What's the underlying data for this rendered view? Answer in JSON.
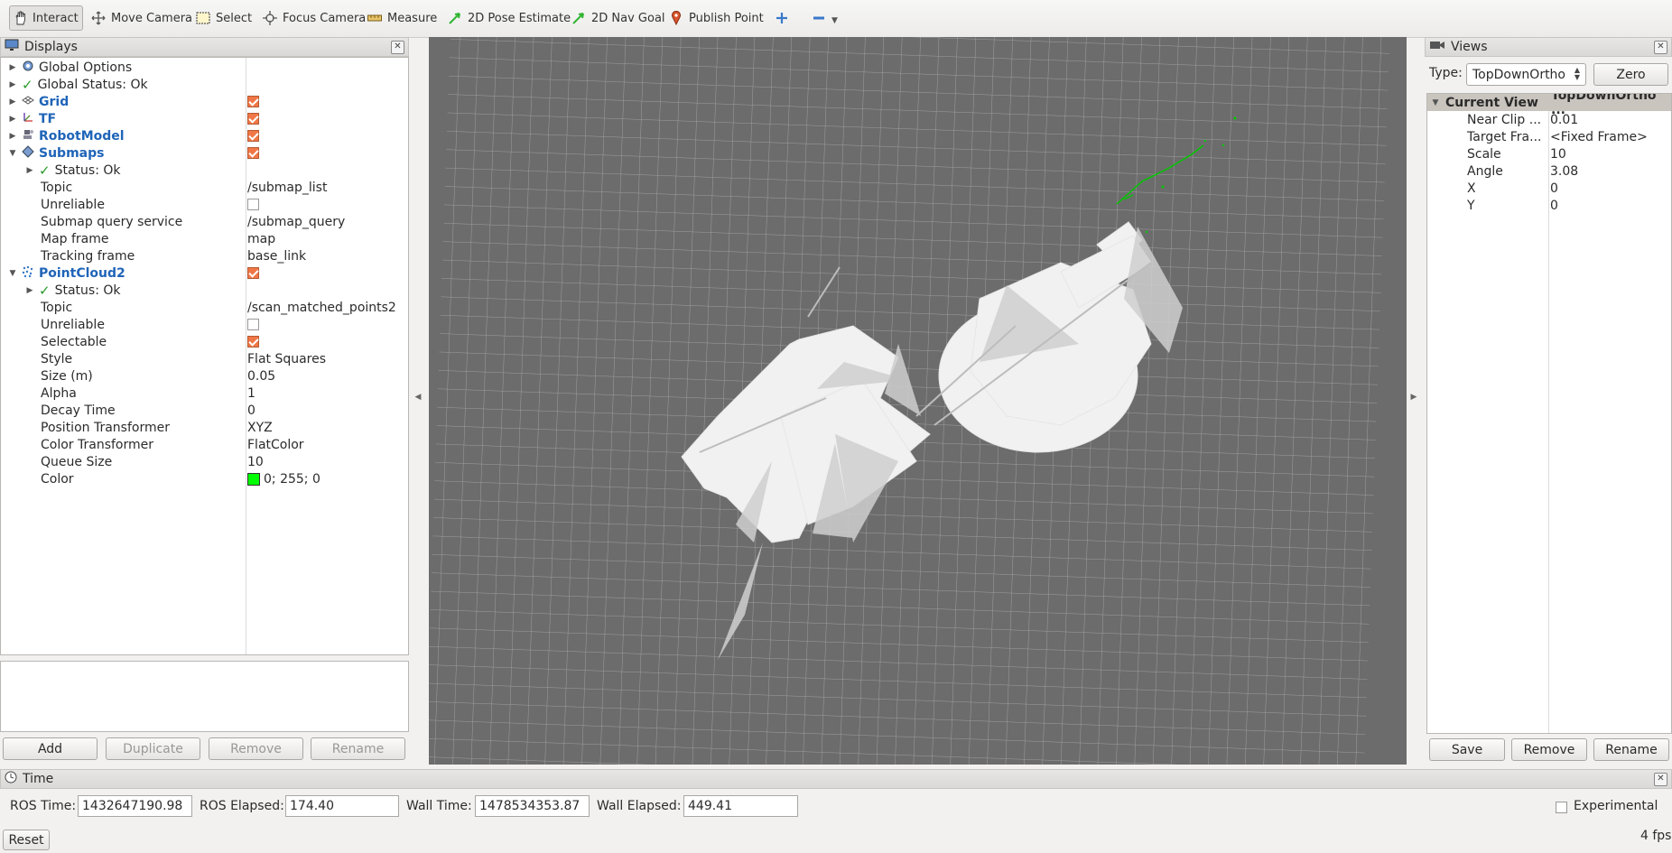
{
  "toolbar": {
    "tools": [
      {
        "label": "Interact",
        "icon": "hand-icon"
      },
      {
        "label": "Move Camera",
        "icon": "move-camera-icon"
      },
      {
        "label": "Select",
        "icon": "select-icon"
      },
      {
        "label": "Focus Camera",
        "icon": "focus-camera-icon"
      },
      {
        "label": "Measure",
        "icon": "ruler-icon"
      },
      {
        "label": "2D Pose Estimate",
        "icon": "pose-arrow-icon"
      },
      {
        "label": "2D Nav Goal",
        "icon": "goal-arrow-icon"
      },
      {
        "label": "Publish Point",
        "icon": "map-pin-icon"
      }
    ],
    "active": "Interact"
  },
  "displays": {
    "title": "Displays",
    "rows": [
      {
        "label": "Global Options"
      },
      {
        "label": "Global Status: Ok"
      },
      {
        "label": "Grid"
      },
      {
        "label": "TF"
      },
      {
        "label": "RobotModel"
      },
      {
        "label": "Submaps"
      },
      {
        "label": "Status: Ok"
      },
      {
        "label": "Topic",
        "value": "/submap_list"
      },
      {
        "label": "Unreliable"
      },
      {
        "label": "Submap query service",
        "value": "/submap_query"
      },
      {
        "label": "Map frame",
        "value": "map"
      },
      {
        "label": "Tracking frame",
        "value": "base_link"
      },
      {
        "label": "PointCloud2"
      },
      {
        "label": "Status: Ok"
      },
      {
        "label": "Topic",
        "value": "/scan_matched_points2"
      },
      {
        "label": "Unreliable"
      },
      {
        "label": "Selectable"
      },
      {
        "label": "Style",
        "value": "Flat Squares"
      },
      {
        "label": "Size (m)",
        "value": "0.05"
      },
      {
        "label": "Alpha",
        "value": "1"
      },
      {
        "label": "Decay Time",
        "value": "0"
      },
      {
        "label": "Position Transformer",
        "value": "XYZ"
      },
      {
        "label": "Color Transformer",
        "value": "FlatColor"
      },
      {
        "label": "Queue Size",
        "value": "10"
      },
      {
        "label": "Color",
        "value": "0; 255; 0"
      }
    ],
    "buttons": {
      "add": "Add",
      "duplicate": "Duplicate",
      "remove": "Remove",
      "rename": "Rename"
    }
  },
  "views": {
    "title": "Views",
    "type_label": "Type:",
    "type_value": "TopDownOrtho",
    "zero_label": "Zero",
    "header": {
      "col1": "Current View",
      "col2": "TopDownOrtho ..."
    },
    "props": [
      {
        "label": "Near Clip ...",
        "value": "0.01"
      },
      {
        "label": "Target Fra...",
        "value": "<Fixed Frame>"
      },
      {
        "label": "Scale",
        "value": "10"
      },
      {
        "label": "Angle",
        "value": "3.08"
      },
      {
        "label": "X",
        "value": "0"
      },
      {
        "label": "Y",
        "value": "0"
      }
    ],
    "buttons": {
      "save": "Save",
      "remove": "Remove",
      "rename": "Rename"
    }
  },
  "time": {
    "title": "Time",
    "ros_time_label": "ROS Time:",
    "ros_time": "1432647190.98",
    "ros_elapsed_label": "ROS Elapsed:",
    "ros_elapsed": "174.40",
    "wall_time_label": "Wall Time:",
    "wall_time": "1478534353.87",
    "wall_elapsed_label": "Wall Elapsed:",
    "wall_elapsed": "449.41",
    "experimental_label": "Experimental",
    "reset_label": "Reset",
    "fps": "4 fps"
  },
  "colors": {
    "accent_checkbox": "#f07746",
    "tree_blue": "#1f64b8",
    "point_cloud": "#00ff00",
    "viewport_bg": "#6c6c6c"
  }
}
